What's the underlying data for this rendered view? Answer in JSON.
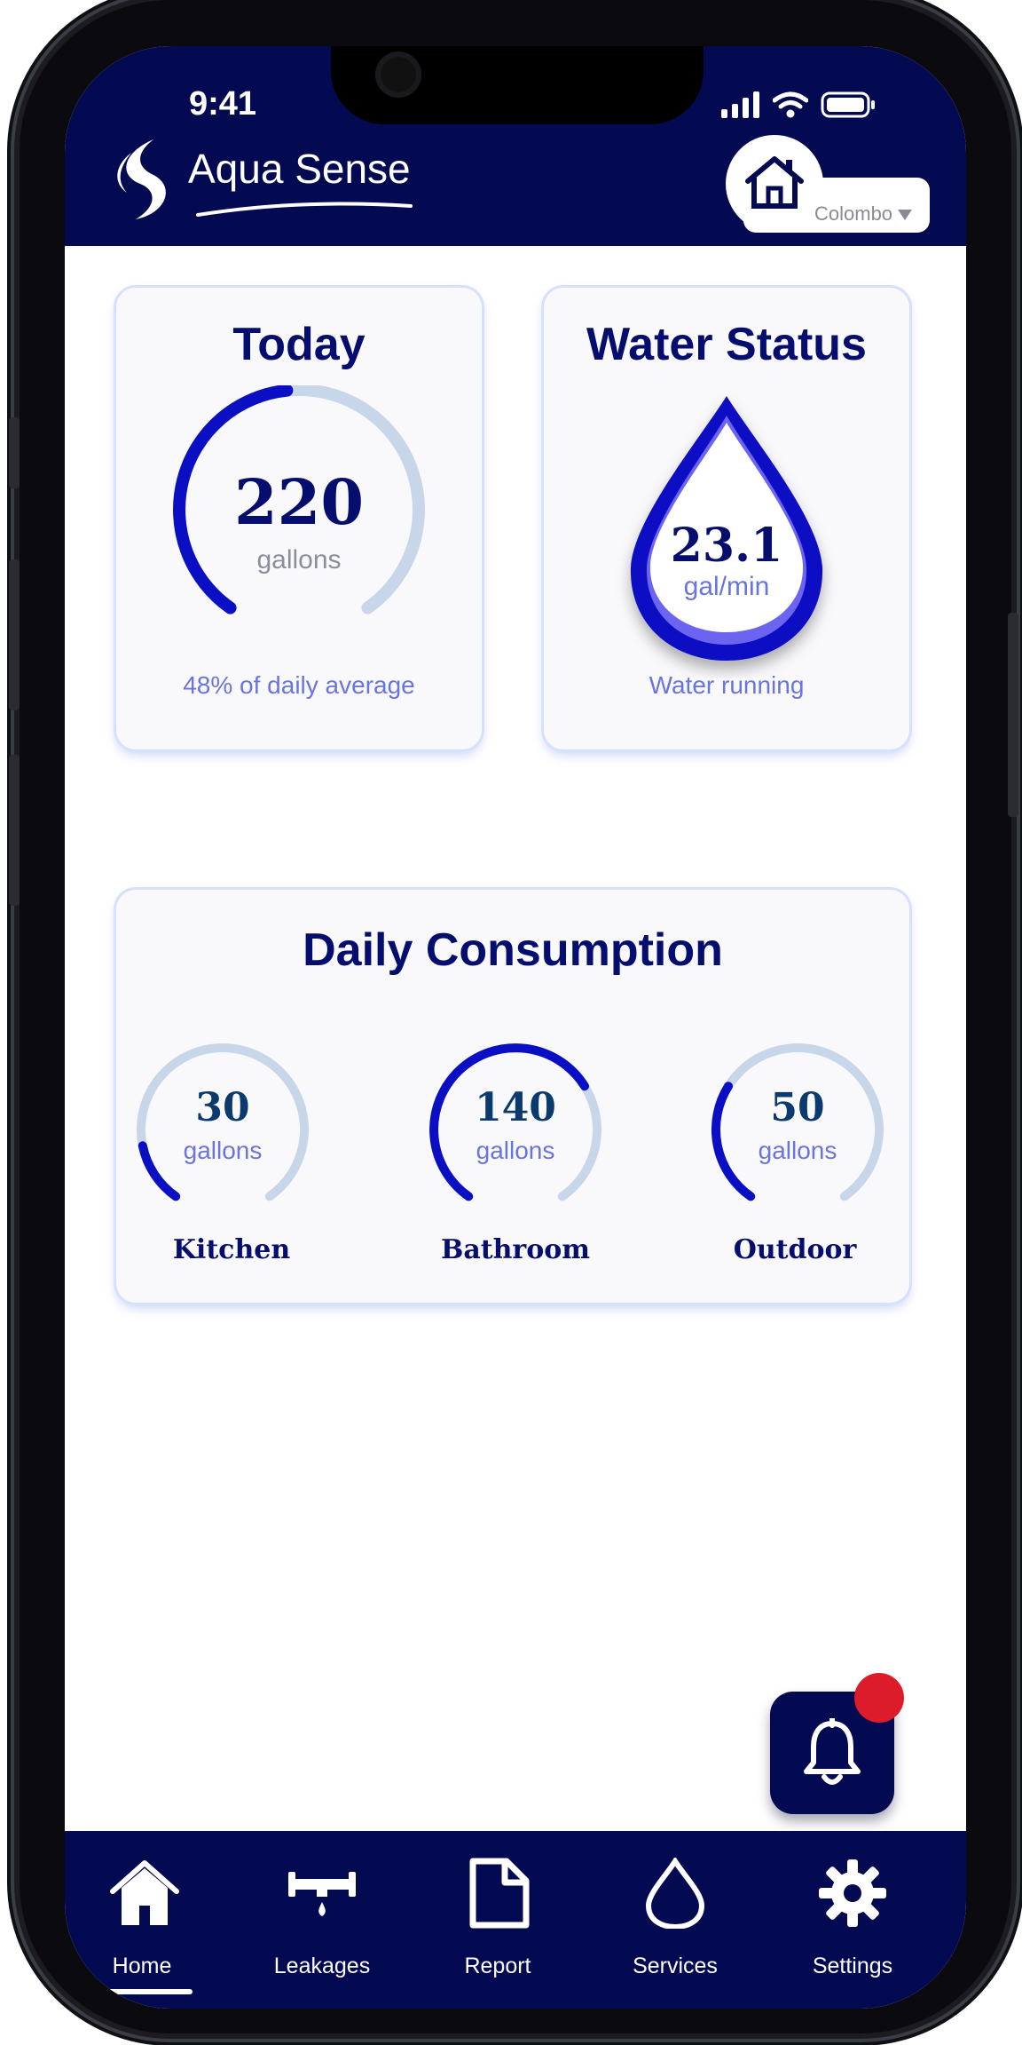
{
  "status_bar": {
    "time": "9:41"
  },
  "app": {
    "name": "Aqua Sense"
  },
  "location": {
    "selected": "Colombo"
  },
  "today_card": {
    "title": "Today",
    "value": "220",
    "unit": "gallons",
    "subtitle": "48% of daily average",
    "progress_fraction": 0.48
  },
  "water_status_card": {
    "title": "Water Status",
    "flow_value": "23.1",
    "flow_unit": "gal/min",
    "status": "Water running"
  },
  "daily_consumption": {
    "title": "Daily Consumption",
    "items": [
      {
        "value": "30",
        "unit": "gallons",
        "label": "Kitchen",
        "progress_fraction": 0.15
      },
      {
        "value": "140",
        "unit": "gallons",
        "label": "Bathroom",
        "progress_fraction": 0.7
      },
      {
        "value": "50",
        "unit": "gallons",
        "label": "Outdoor",
        "progress_fraction": 0.3
      }
    ]
  },
  "nav": {
    "items": [
      {
        "label": "Home",
        "icon": "home-icon",
        "active": true
      },
      {
        "label": "Leakages",
        "icon": "leak-pipe-icon",
        "active": false
      },
      {
        "label": "Report",
        "icon": "document-icon",
        "active": false
      },
      {
        "label": "Services",
        "icon": "water-drop-icon",
        "active": false
      },
      {
        "label": "Settings",
        "icon": "gear-icon",
        "active": false
      }
    ]
  },
  "colors": {
    "primary_navy": "#030a52",
    "accent_blue": "#0a0fc4",
    "track_light": "#c8d6ea",
    "badge_red": "#dc1c2a"
  }
}
